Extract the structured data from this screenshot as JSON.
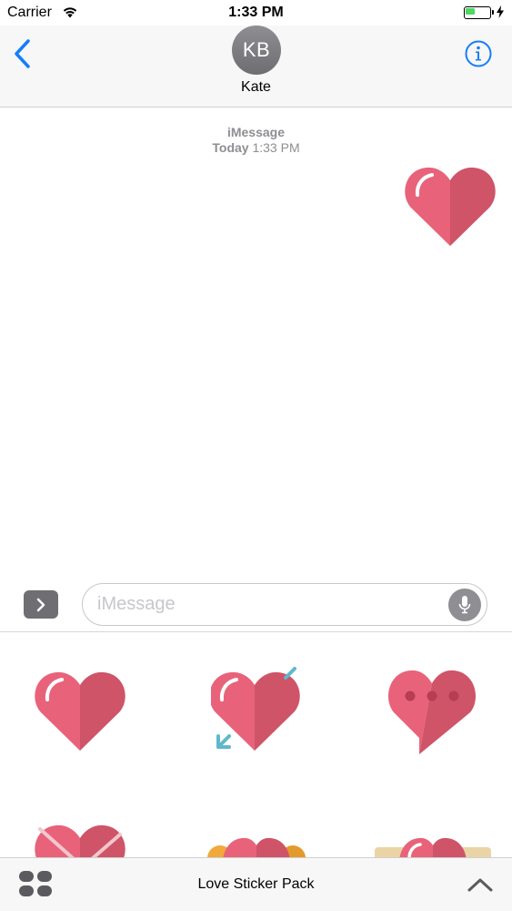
{
  "status_bar": {
    "carrier": "Carrier",
    "time": "1:33 PM"
  },
  "nav": {
    "avatar_initials": "KB",
    "contact_name": "Kate"
  },
  "transcript": {
    "service": "iMessage",
    "day": "Today",
    "time": "1:33 PM"
  },
  "composer": {
    "placeholder": "iMessage"
  },
  "tray": {
    "pack_name": "Love Sticker Pack"
  },
  "colors": {
    "accent": "#157efb",
    "heart_light": "#e8637a",
    "heart_dark": "#cf5468",
    "arrow": "#5fb8cc",
    "battery": "#4cd964"
  }
}
